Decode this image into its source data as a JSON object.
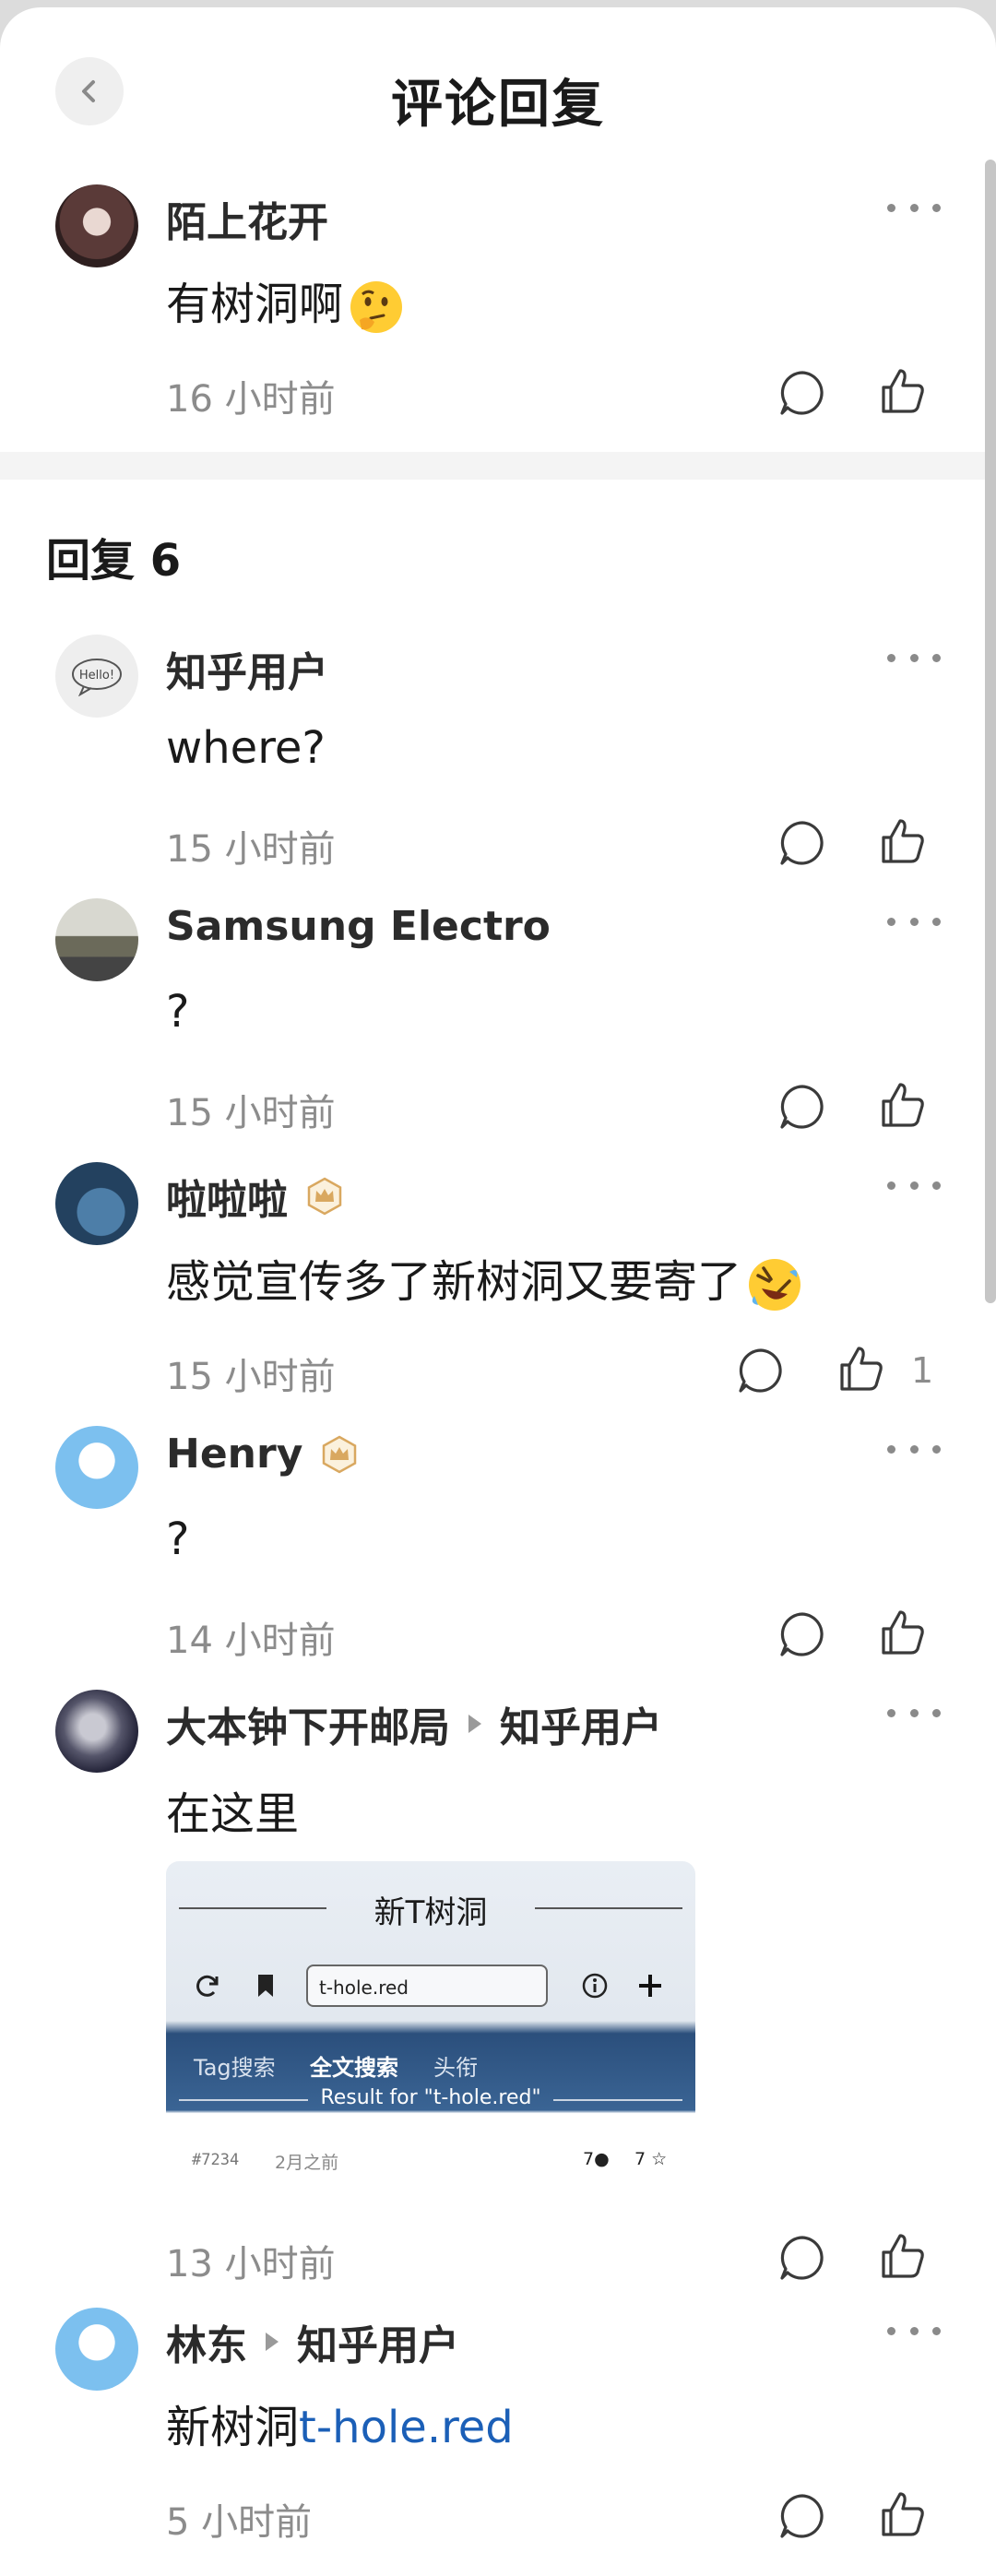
{
  "header": {
    "title": "评论回复",
    "back_icon": "chevron-left-icon"
  },
  "root_comment": {
    "author": "陌上花开",
    "text": "有树洞啊",
    "emoji": "thinking-face",
    "time": "16 小时前"
  },
  "replies_section": {
    "title": "回复 6"
  },
  "replies": [
    {
      "author": "知乎用户",
      "text": "where?",
      "time": "15 小时前"
    },
    {
      "author": "Samsung Electro",
      "text": "?",
      "time": "15 小时前"
    },
    {
      "author": "啦啦啦",
      "badge": "crown-badge",
      "text": "感觉宣传多了新树洞又要寄了",
      "emoji": "rolling-laughing-face",
      "time": "15 小时前",
      "likes": "1"
    },
    {
      "author": "Henry",
      "badge": "crown-badge",
      "text": "?",
      "time": "14 小时前"
    },
    {
      "author": "大本钟下开邮局",
      "reply_to": "知乎用户",
      "text": "在这里",
      "time": "13 小时前",
      "image": {
        "title": "新T树洞",
        "search_value": "t-hole.red",
        "tabs": [
          "Tag搜索",
          "全文搜索",
          "头衔"
        ],
        "result": "Result for \"t-hole.red\"",
        "post_id": "#7234",
        "post_time": "2月之前",
        "replies_count": "7",
        "stars_count": "7"
      }
    },
    {
      "author": "林东",
      "reply_to": "知乎用户",
      "text_prefix": "新树洞",
      "link": "t-hole.red",
      "time": "5 小时前"
    }
  ],
  "colors": {
    "accent_link": "#1b5fb7",
    "meta_gray": "#8c8c8c",
    "background": "#ffffff"
  }
}
